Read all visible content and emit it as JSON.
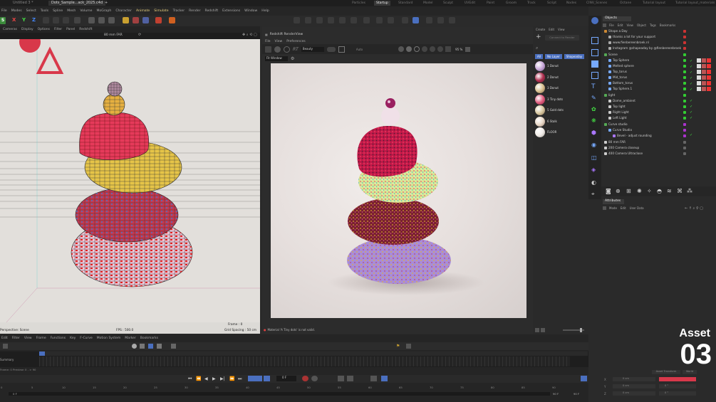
{
  "tabs": {
    "docs": [
      "Untitled 3 *",
      "Dots_Sample...ack_2025.c4d"
    ],
    "add": "+",
    "layouts": [
      "Particles",
      "Startup",
      "Standard",
      "Model",
      "Sculpt",
      "UVEdit",
      "Paint",
      "Groom",
      "Track",
      "Script",
      "Nodes",
      "CINV_Scenes",
      "Octane",
      "Tutorial layout",
      "Tutorial layout_materials"
    ],
    "active_layout": "Startup"
  },
  "menubar": [
    "File",
    "Modes",
    "Select",
    "Tools",
    "Spline",
    "Mesh",
    "Volume",
    "MoGraph",
    "Character",
    "Animate",
    "Simulate",
    "Tracker",
    "Render",
    "Redshift",
    "Extensions",
    "Window",
    "Help"
  ],
  "viewport": {
    "menu": [
      "Cameras",
      "Display",
      "Options",
      "Filter",
      "Panel",
      "Redshift"
    ],
    "camera": "80 mm FAR",
    "status_left": "Perspective: Scene",
    "fps": "FPS : 500.0",
    "frame": "Frame : 0",
    "grid": "Grid Spacing : 50 cm"
  },
  "renderview": {
    "title": "Redshift RenderView",
    "menu": [
      "File",
      "View",
      "Preferences"
    ],
    "mode": "Beauty",
    "rt": "RT",
    "auto": "Auto",
    "zoom": "95 %",
    "window": "Fit Window",
    "status": "Material 'A Tiny dots' is not valid."
  },
  "materials": {
    "menu": [
      "Create",
      "Edit",
      "View"
    ],
    "filters": [
      "All",
      "No Layer",
      "Shapeaday"
    ],
    "connect": "Connect to Render",
    "items": [
      {
        "name": "1 Donut",
        "color": "#c8a8d8"
      },
      {
        "name": "2 Donut",
        "color": "#b03050"
      },
      {
        "name": "3 Donut",
        "color": "#d8c090"
      },
      {
        "name": "3 Tiny dots",
        "color": "#e06080"
      },
      {
        "name": "5 Gold dots",
        "color": "#d8c8a0"
      },
      {
        "name": "6 Stalk",
        "color": "#e8d8c8"
      },
      {
        "name": "FLOOR",
        "color": "#f0ece8"
      }
    ]
  },
  "objects": {
    "title": "Objects",
    "menu": [
      "File",
      "Edit",
      "View",
      "Object",
      "Tags",
      "Bookmarks"
    ],
    "tree": [
      {
        "name": "Shape a Day",
        "color": "#c83"
      },
      {
        "name": "thanks a lot for your support",
        "color": "#aaa"
      },
      {
        "name": "www.fienbereenbroek.nl",
        "color": "#aaa"
      },
      {
        "name": "Instagram @shapeaday by @fienbereenbroek",
        "color": "#aaa"
      },
      {
        "name": "Scene",
        "color": "#5a5"
      },
      {
        "name": "Top Sphere",
        "color": "#7af"
      },
      {
        "name": "Melted sphere",
        "color": "#7af"
      },
      {
        "name": "Top_torus",
        "color": "#7af"
      },
      {
        "name": "Mid_torus",
        "color": "#7af"
      },
      {
        "name": "Bottom_torus",
        "color": "#7af"
      },
      {
        "name": "Top Sphere.1",
        "color": "#7af"
      },
      {
        "name": "light",
        "color": "#5a5"
      },
      {
        "name": "Dome_ambient",
        "color": "#ccc"
      },
      {
        "name": "Top light",
        "color": "#ccc"
      },
      {
        "name": "Right Light",
        "color": "#ccc"
      },
      {
        "name": "Left Light",
        "color": "#ccc"
      },
      {
        "name": "Curve studio",
        "color": "#5a5"
      },
      {
        "name": "Curve Studio",
        "color": "#7af"
      },
      {
        "name": "Bevel - adjust rounding",
        "color": "#a7f"
      },
      {
        "name": "80 mm FAR",
        "color": "#ccc"
      },
      {
        "name": "200 Camera closeup",
        "color": "#ccc"
      },
      {
        "name": "400 Camera Ultraclose",
        "color": "#ccc"
      }
    ]
  },
  "attributes": {
    "title": "Attributes",
    "menu": [
      "Mode",
      "Edit",
      "User Data"
    ],
    "fields": [
      "X",
      "Y",
      "Z"
    ],
    "values": [
      "0 cm",
      "0 cm",
      "0 cm"
    ],
    "rot": [
      "0 °",
      "0 °",
      "0 °"
    ],
    "tabs": [
      "Asset Transform",
      "World"
    ]
  },
  "timeline": {
    "menu": [
      "Edit",
      "Filter",
      "View",
      "Frame",
      "Functions",
      "Key",
      "F-Curve",
      "Motion System",
      "Marker",
      "Bookmarks"
    ],
    "summary": "Summary",
    "frame_label": "Frame: 0 Preview: 0 - > 90",
    "ticks": [
      "0",
      "5",
      "10",
      "15",
      "20",
      "25",
      "30",
      "35",
      "40",
      "45",
      "50",
      "55",
      "60",
      "65",
      "70",
      "75",
      "80",
      "85",
      "90"
    ],
    "current": "0 F",
    "start": "0 F",
    "end": "90 F",
    "end2": "90 F"
  },
  "overlay": {
    "asset_label": "Asset",
    "asset_number": "03"
  },
  "colors": {
    "accent": "#4a6fbf",
    "brand_red": "#d8384a"
  }
}
